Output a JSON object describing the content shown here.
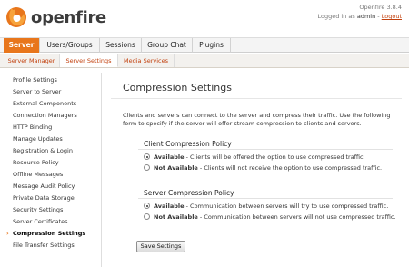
{
  "header": {
    "logo_text": "openfire",
    "version": "Openfire 3.8.4",
    "logged_in_as_label": "Logged in as",
    "username": "admin",
    "logout_label": "Logout"
  },
  "main_tabs": [
    {
      "label": "Server",
      "active": true
    },
    {
      "label": "Users/Groups",
      "active": false
    },
    {
      "label": "Sessions",
      "active": false
    },
    {
      "label": "Group Chat",
      "active": false
    },
    {
      "label": "Plugins",
      "active": false
    }
  ],
  "sub_tabs": [
    {
      "label": "Server Manager",
      "active": false
    },
    {
      "label": "Server Settings",
      "active": true
    },
    {
      "label": "Media Services",
      "active": false
    }
  ],
  "sidebar": {
    "items": [
      {
        "label": "Profile Settings"
      },
      {
        "label": "Server to Server"
      },
      {
        "label": "External Components"
      },
      {
        "label": "Connection Managers"
      },
      {
        "label": "HTTP Binding"
      },
      {
        "label": "Manage Updates"
      },
      {
        "label": "Registration & Login"
      },
      {
        "label": "Resource Policy"
      },
      {
        "label": "Offline Messages"
      },
      {
        "label": "Message Audit Policy"
      },
      {
        "label": "Private Data Storage"
      },
      {
        "label": "Security Settings"
      },
      {
        "label": "Server Certificates"
      },
      {
        "label": "Compression Settings",
        "active": true
      },
      {
        "label": "File Transfer Settings"
      }
    ]
  },
  "content": {
    "title": "Compression Settings",
    "intro": "Clients and servers can connect to the server and compress their traffic. Use the following form to specify if the server will offer stream compression to clients and servers.",
    "client_policy": {
      "heading": "Client Compression Policy",
      "options": [
        {
          "label": "Available",
          "description": "- Clients will be offered the option to use compressed traffic.",
          "checked": true
        },
        {
          "label": "Not Available",
          "description": "- Clients will not receive the option to use compressed traffic.",
          "checked": false
        }
      ]
    },
    "server_policy": {
      "heading": "Server Compression Policy",
      "options": [
        {
          "label": "Available",
          "description": "- Communication between servers will try to use compressed traffic.",
          "checked": true
        },
        {
          "label": "Not Available",
          "description": "- Communication between servers will not use compressed traffic.",
          "checked": false
        }
      ]
    },
    "save_label": "Save Settings"
  },
  "colors": {
    "accent": "#e8761c",
    "link": "#c2400d"
  }
}
